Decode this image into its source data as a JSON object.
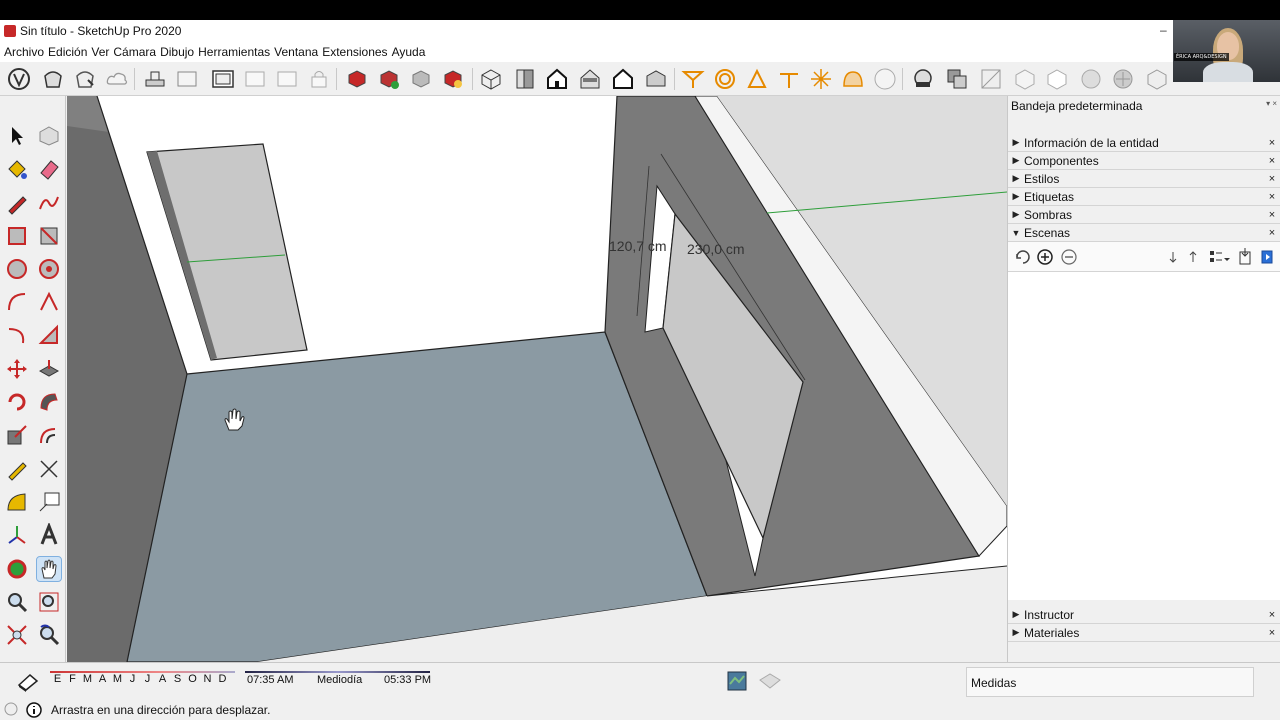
{
  "window": {
    "title": "Sin título - SketchUp Pro 2020",
    "minimize_glyph": "–"
  },
  "menu": {
    "items": [
      "Archivo",
      "Edición",
      "Ver",
      "Cámara",
      "Dibujo",
      "Herramientas",
      "Ventana",
      "Extensiones",
      "Ayuda"
    ]
  },
  "webcam": {
    "name_tag": "ÉRICA ARQ&DESIGN"
  },
  "viewport": {
    "dim_width": "120,7 cm",
    "dim_height": "230,0 cm"
  },
  "tray": {
    "title": "Bandeja predeterminada",
    "ctrl": "▾ ×",
    "panels": [
      {
        "label": "Información de la entidad",
        "arrow": "▶"
      },
      {
        "label": "Componentes",
        "arrow": "▶"
      },
      {
        "label": "Estilos",
        "arrow": "▶"
      },
      {
        "label": "Etiquetas",
        "arrow": "▶"
      },
      {
        "label": "Sombras",
        "arrow": "▶"
      },
      {
        "label": "Escenas",
        "arrow": "▼"
      }
    ],
    "bottom_panels": [
      {
        "label": "Instructor",
        "arrow": "▶"
      },
      {
        "label": "Materiales",
        "arrow": "▶"
      }
    ],
    "close_glyph": "×"
  },
  "status": {
    "months": [
      "E",
      "F",
      "M",
      "A",
      "M",
      "J",
      "J",
      "A",
      "S",
      "O",
      "N",
      "D"
    ],
    "sunrise": "07:35 AM",
    "noon": "Mediodía",
    "sunset": "05:33 PM",
    "measurements_label": "Medidas",
    "hint": "Arrastra en una dirección para desplazar."
  },
  "colors": {
    "accent_red": "#c62828",
    "floor": "#8b9aa3",
    "wall": "#777777",
    "green_axis": "#2e9e3a"
  },
  "icons": {
    "selected_tool": "pan-hand-icon"
  }
}
